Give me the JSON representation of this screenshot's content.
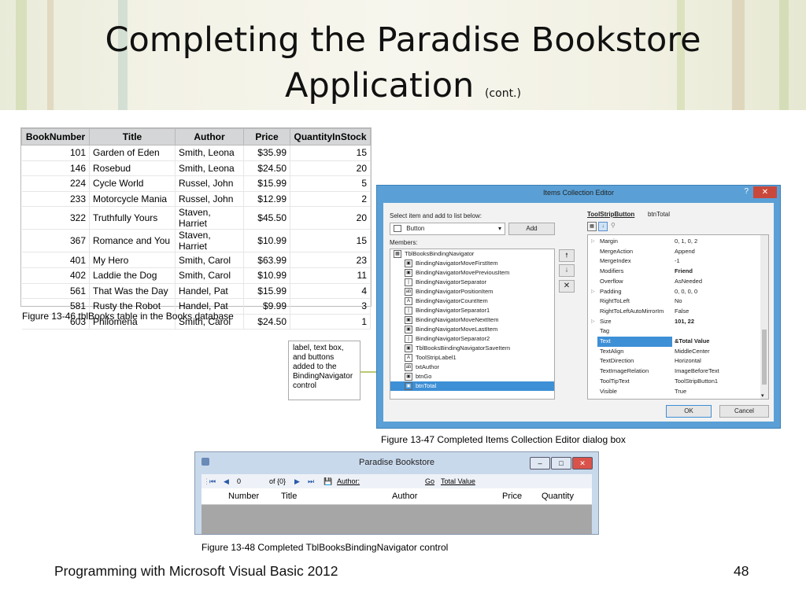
{
  "slide": {
    "title_line1": "Completing the Paradise Bookstore",
    "title_line2": "Application",
    "title_suffix": "(cont.)",
    "footer_left": "Programming with Microsoft Visual Basic 2012",
    "page_number": "48"
  },
  "books_table": {
    "headers": [
      "BookNumber",
      "Title",
      "Author",
      "Price",
      "QuantityInStock"
    ],
    "rows": [
      [
        "101",
        "Garden of Eden",
        "Smith, Leona",
        "$35.99",
        "15"
      ],
      [
        "146",
        "Rosebud",
        "Smith, Leona",
        "$24.50",
        "20"
      ],
      [
        "224",
        "Cycle World",
        "Russel, John",
        "$15.99",
        "5"
      ],
      [
        "233",
        "Motorcycle Mania",
        "Russel, John",
        "$12.99",
        "2"
      ],
      [
        "322",
        "Truthfully Yours",
        "Staven, Harriet",
        "$45.50",
        "20"
      ],
      [
        "367",
        "Romance and You",
        "Staven, Harriet",
        "$10.99",
        "15"
      ],
      [
        "401",
        "My Hero",
        "Smith, Carol",
        "$63.99",
        "23"
      ],
      [
        "402",
        "Laddie the Dog",
        "Smith, Carol",
        "$10.99",
        "11"
      ],
      [
        "561",
        "That Was the Day",
        "Handel, Pat",
        "$15.99",
        "4"
      ],
      [
        "581",
        "Rusty the Robot",
        "Handel, Pat",
        "$9.99",
        "3"
      ],
      [
        "603",
        "Philomena",
        "Smith, Carol",
        "$24.50",
        "1"
      ]
    ],
    "caption": "Figure 13-46 tblBooks table in the Books database"
  },
  "dialog": {
    "title": "Items Collection Editor",
    "help": "?",
    "close": "✕",
    "select_label": "Select item and add to list below:",
    "select_value": "Button",
    "add_label": "Add",
    "members_label": "Members:",
    "members": [
      {
        "icon": "▦",
        "label": "TblBooksBindingNavigator",
        "indent": 0
      },
      {
        "icon": "▣",
        "label": "BindingNavigatorMoveFirstItem",
        "indent": 1
      },
      {
        "icon": "▣",
        "label": "BindingNavigatorMovePreviousItem",
        "indent": 1
      },
      {
        "icon": "|",
        "label": "BindingNavigatorSeparator",
        "indent": 1
      },
      {
        "icon": "ab",
        "label": "BindingNavigatorPositionItem",
        "indent": 1
      },
      {
        "icon": "A",
        "label": "BindingNavigatorCountItem",
        "indent": 1
      },
      {
        "icon": "|",
        "label": "BindingNavigatorSeparator1",
        "indent": 1
      },
      {
        "icon": "▣",
        "label": "BindingNavigatorMoveNextItem",
        "indent": 1
      },
      {
        "icon": "▣",
        "label": "BindingNavigatorMoveLastItem",
        "indent": 1
      },
      {
        "icon": "|",
        "label": "BindingNavigatorSeparator2",
        "indent": 1
      },
      {
        "icon": "▣",
        "label": "TblBooksBindingNavigatorSaveItem",
        "indent": 1
      },
      {
        "icon": "A",
        "label": "ToolStripLabel1",
        "indent": 1
      },
      {
        "icon": "ab",
        "label": "txtAuthor",
        "indent": 1
      },
      {
        "icon": "▣",
        "label": "btnGo",
        "indent": 1
      },
      {
        "icon": "▣",
        "label": "btnTotal",
        "indent": 1,
        "selected": true
      }
    ],
    "header_type": "ToolStripButton",
    "header_name": "btnTotal",
    "properties": [
      {
        "key": "Margin",
        "value": "0, 1, 0, 2",
        "expand": true
      },
      {
        "key": "MergeAction",
        "value": "Append"
      },
      {
        "key": "MergeIndex",
        "value": "-1"
      },
      {
        "key": "Modifiers",
        "value": "Friend",
        "bold": true
      },
      {
        "key": "Overflow",
        "value": "AsNeeded"
      },
      {
        "key": "Padding",
        "value": "0, 0, 0, 0",
        "expand": true
      },
      {
        "key": "RightToLeft",
        "value": "No"
      },
      {
        "key": "RightToLeftAutoMirrorIm",
        "value": "False"
      },
      {
        "key": "Size",
        "value": "101, 22",
        "expand": true,
        "bold": true
      },
      {
        "key": "Tag",
        "value": ""
      },
      {
        "key": "Text",
        "value": "&Total Value",
        "selected": true,
        "bold": true
      },
      {
        "key": "TextAlign",
        "value": "MiddleCenter"
      },
      {
        "key": "TextDirection",
        "value": "Horizontal"
      },
      {
        "key": "TextImageRelation",
        "value": "ImageBeforeText"
      },
      {
        "key": "ToolTipText",
        "value": "ToolStripButton1"
      },
      {
        "key": "Visible",
        "value": "True"
      }
    ],
    "ok_label": "OK",
    "cancel_label": "Cancel",
    "caption": "Figure 13-47 Completed Items Collection Editor dialog box"
  },
  "callout": {
    "text": "label, text box, and buttons added to the BindingNavigator control"
  },
  "navigator_window": {
    "title": "Paradise Bookstore",
    "position_value": "0",
    "count_text": "of {0}",
    "author_label": "Author:",
    "go_label": "Go",
    "total_label": "Total Value",
    "columns": [
      "Number",
      "Title",
      "Author",
      "Price",
      "Quantity"
    ],
    "caption": "Figure 13-48 Completed TblBooksBindingNavigator control"
  }
}
